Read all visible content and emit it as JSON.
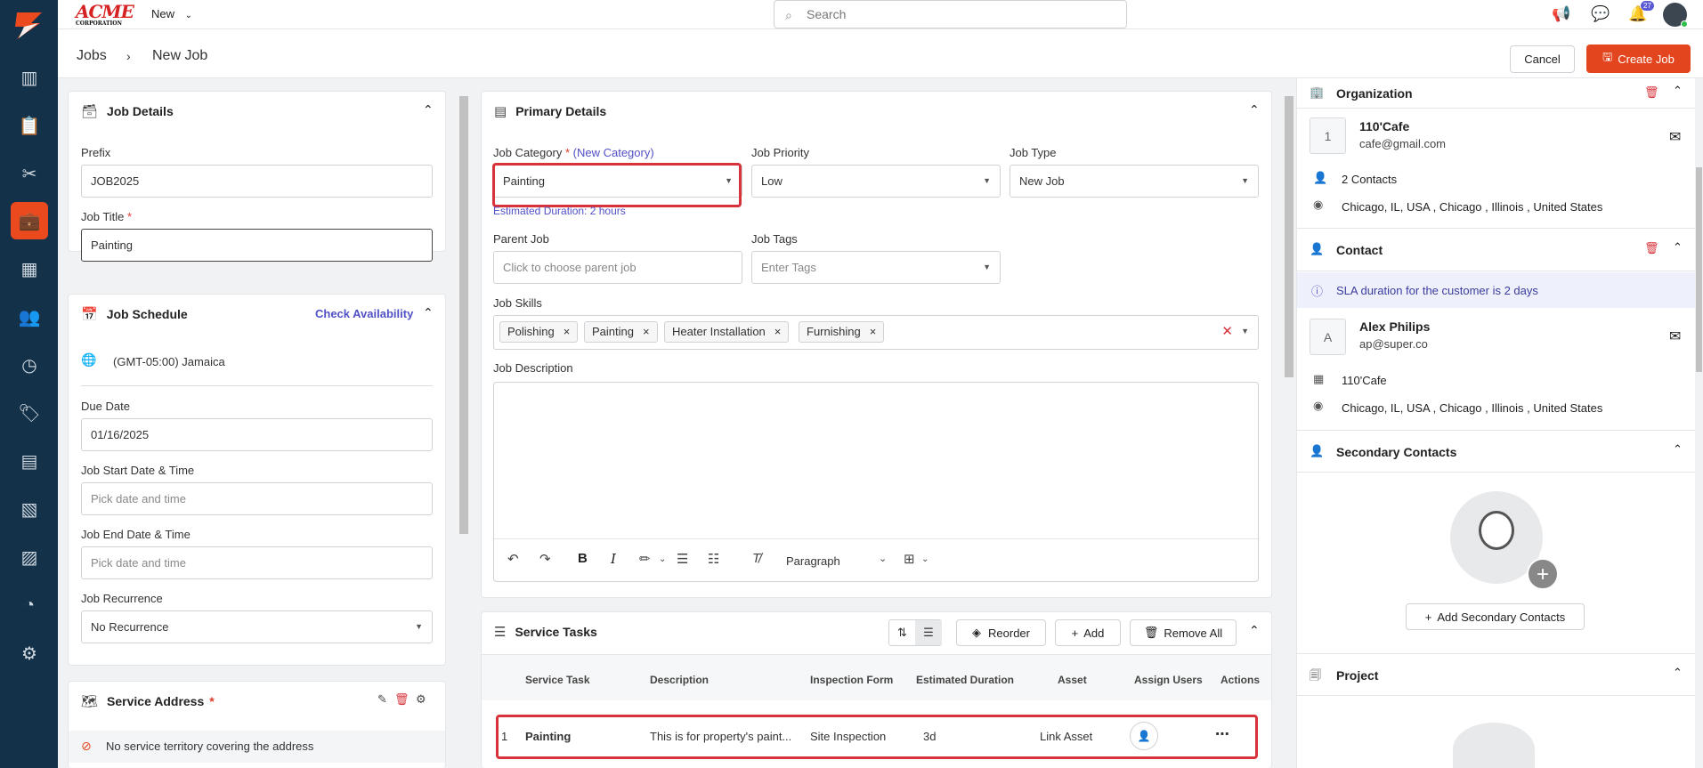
{
  "topbar": {
    "brand": "ACME",
    "brand_sub": "CORPORATION",
    "new_label": "New",
    "search_placeholder": "Search",
    "notif_count": "27"
  },
  "breadcrumb": {
    "root": "Jobs",
    "current": "New Job"
  },
  "actions": {
    "cancel": "Cancel",
    "create": "Create Job"
  },
  "job_details": {
    "title": "Job Details",
    "prefix_label": "Prefix",
    "prefix_value": "JOB2025",
    "job_title_label": "Job Title",
    "job_title_value": "Painting"
  },
  "job_schedule": {
    "title": "Job Schedule",
    "check_availability": "Check Availability",
    "timezone": "(GMT-05:00) Jamaica",
    "due_date_label": "Due Date",
    "due_date_value": "01/16/2025",
    "start_label": "Job Start Date & Time",
    "start_placeholder": "Pick date and time",
    "end_label": "Job End Date & Time",
    "end_placeholder": "Pick date and time",
    "recurrence_label": "Job Recurrence",
    "recurrence_value": "No Recurrence"
  },
  "service_address": {
    "title": "Service Address",
    "notice": "No service territory covering the address"
  },
  "primary_details": {
    "title": "Primary Details",
    "category_label": "Job Category",
    "new_category": "(New Category)",
    "category_value": "Painting",
    "estimated_duration": "Estimated Duration: 2 hours",
    "priority_label": "Job Priority",
    "priority_value": "Low",
    "type_label": "Job Type",
    "type_value": "New Job",
    "parent_label": "Parent Job",
    "parent_placeholder": "Click to choose parent job",
    "tags_label": "Job Tags",
    "tags_placeholder": "Enter Tags",
    "skills_label": "Job Skills",
    "skills": [
      "Polishing",
      "Painting",
      "Heater Installation",
      "Furnishing"
    ],
    "description_label": "Job Description",
    "paragraph_select": "Paragraph"
  },
  "service_tasks": {
    "title": "Service Tasks",
    "reorder": "Reorder",
    "add": "Add",
    "remove_all": "Remove All",
    "columns": [
      "Service Task",
      "Description",
      "Inspection Form",
      "Estimated Duration",
      "Asset",
      "Assign Users",
      "Actions"
    ],
    "rows": [
      {
        "index": "1",
        "task": "Painting",
        "description": "This is for property's paint...",
        "form": "Site Inspection",
        "duration": "3d",
        "asset": "Link Asset"
      }
    ]
  },
  "organization": {
    "title": "Organization",
    "initial": "1",
    "name": "110'Cafe",
    "email": "cafe@gmail.com",
    "contacts": "2 Contacts",
    "address": "Chicago, IL, USA , Chicago , Illinois , United States"
  },
  "contact": {
    "title": "Contact",
    "sla": "SLA duration for the customer is 2 days",
    "initial": "A",
    "name": "Alex Philips",
    "email": "ap@super.co",
    "org": "110'Cafe",
    "address": "Chicago, IL, USA , Chicago , Illinois , United States"
  },
  "secondary_contacts": {
    "title": "Secondary Contacts",
    "add_label": "Add Secondary Contacts"
  },
  "project": {
    "title": "Project"
  },
  "colors": {
    "sidebar": "#133148",
    "accent": "#e3461f",
    "link": "#5150c6",
    "highlight": "#d8333a"
  }
}
